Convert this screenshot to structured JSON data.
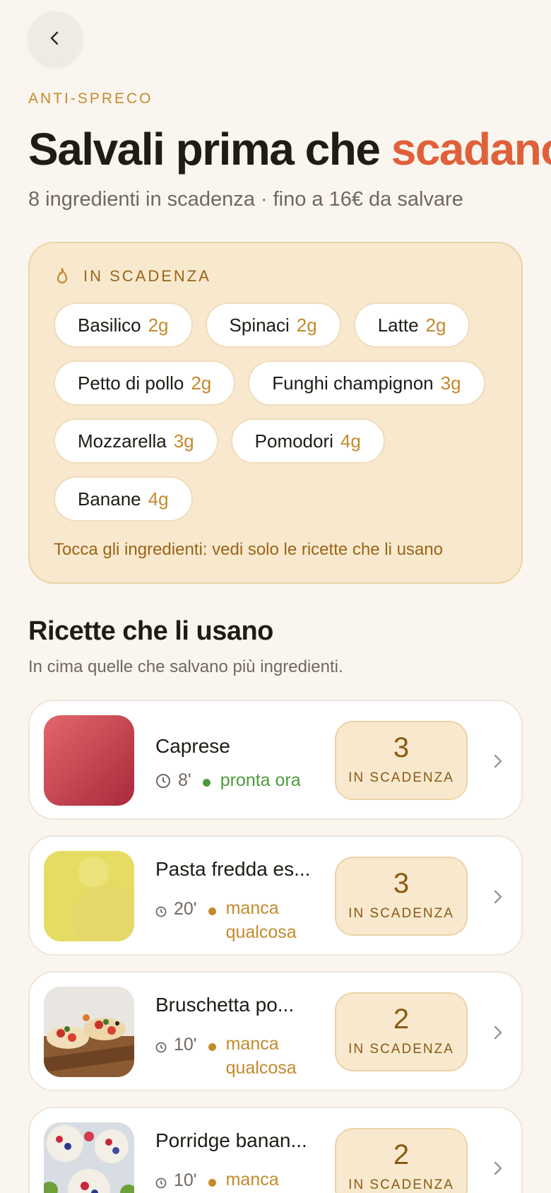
{
  "header": {
    "back_icon": "chevron-left-icon",
    "eyebrow": "ANTI-SPRECO",
    "title_main": "Salvali prima che ",
    "title_accent": "scadano",
    "subtitle": "8 ingredienti in scadenza · fino a 16€ da salvare"
  },
  "colors": {
    "accent": "#e0603a",
    "gold": "#c48a2c",
    "card_bg": "#f8e9ce",
    "ok": "#4e9a3d"
  },
  "expiring": {
    "icon": "flame-icon",
    "heading": "IN SCADENZA",
    "chips": [
      {
        "name": "Basilico",
        "qty": "2g"
      },
      {
        "name": "Spinaci",
        "qty": "2g"
      },
      {
        "name": "Latte",
        "qty": "2g"
      },
      {
        "name": "Petto di pollo",
        "qty": "2g"
      },
      {
        "name": "Funghi champignon",
        "qty": "3g"
      },
      {
        "name": "Mozzarella",
        "qty": "3g"
      },
      {
        "name": "Pomodori",
        "qty": "4g"
      },
      {
        "name": "Banane",
        "qty": "4g"
      }
    ],
    "hint": "Tocca gli ingredienti: vedi solo le ricette che li usano"
  },
  "recipes_section": {
    "title": "Ricette che li usano",
    "subtitle": "In cima quelle che salvano più ingredienti.",
    "items": [
      {
        "name": "Caprese",
        "time": "8'",
        "status": "pronta ora",
        "count": "3",
        "count_label": "IN SCADENZA"
      },
      {
        "name": "Pasta fredda es...",
        "time": "20'",
        "status": "manca qualcosa",
        "count": "3",
        "count_label": "IN SCADENZA"
      },
      {
        "name": "Bruschetta po...",
        "time": "10'",
        "status": "manca qualcosa",
        "count": "2",
        "count_label": "IN SCADENZA"
      },
      {
        "name": "Porridge banan...",
        "time": "10'",
        "status": "manca qualcosa",
        "count": "2",
        "count_label": "IN SCADENZA"
      }
    ]
  }
}
